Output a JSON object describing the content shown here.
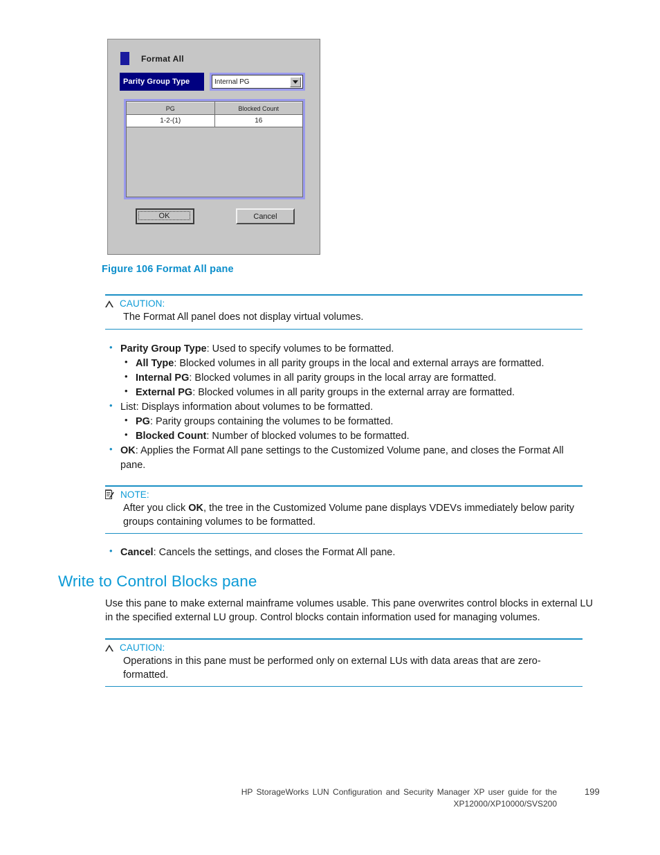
{
  "colors": {
    "hp_cyan": "#0b9ad6",
    "rule_cyan": "#1a8fc4",
    "caption_blue": "#0b8ecb",
    "dialog_navy": "#000080",
    "dialog_face": "#c6c6c6",
    "combo_highlight": "#9a9aee"
  },
  "figure": {
    "dialog": {
      "title": "Format All",
      "parity_group_type_label": "Parity Group Type",
      "parity_group_type_value": "Internal PG",
      "table": {
        "headers": [
          "PG",
          "Blocked Count"
        ],
        "rows": [
          [
            "1-2-(1)",
            "16"
          ]
        ]
      },
      "ok_label": "OK",
      "cancel_label": "Cancel"
    },
    "caption": "Figure 106 Format All pane"
  },
  "caution1": {
    "label": "CAUTION:",
    "body": "The Format All panel does not display virtual volumes."
  },
  "list": {
    "pgt_term": "Parity Group Type",
    "pgt_desc": ":  Used to specify volumes to be formatted.",
    "sub1": [
      {
        "term": "All Type",
        "desc": ": Blocked volumes in all parity groups in the local and external arrays are formatted."
      },
      {
        "term": "Internal PG",
        "desc": ": Blocked volumes in all parity groups in the local array are formatted."
      },
      {
        "term": "External PG",
        "desc": ": Blocked volumes in all parity groups in the external array are formatted."
      }
    ],
    "list_term": "List",
    "list_desc": ":  Displays information about volumes to be formatted.",
    "sub2": [
      {
        "term": "PG",
        "desc": ": Parity groups containing the volumes to be formatted."
      },
      {
        "term": "Blocked Count",
        "desc": ":  Number of blocked volumes to be formatted."
      }
    ],
    "ok_term": "OK",
    "ok_desc": ": Applies the Format All pane settings to the Customized Volume pane, and closes the Format All pane.",
    "cancel_term": "Cancel",
    "cancel_desc": ":  Cancels the settings, and closes the Format All pane."
  },
  "note": {
    "label": "NOTE:",
    "body_pre": "After you click ",
    "body_bold": "OK",
    "body_post": ", the tree in the Customized Volume pane displays VDEVs immediately below parity groups containing volumes to be formatted."
  },
  "section": {
    "heading": "Write to Control Blocks pane",
    "body": "Use this pane to make external mainframe volumes usable.  This pane overwrites control blocks in external LU in the specified external LU group.  Control blocks contain information used for managing volumes."
  },
  "caution2": {
    "label": "CAUTION:",
    "body": "Operations in this pane must be performed only on external LUs with data areas that are zero-formatted."
  },
  "footer": {
    "line1": "HP StorageWorks LUN Configuration and Security Manager XP user guide for the",
    "line2": "XP12000/XP10000/SVS200",
    "page": "199"
  }
}
